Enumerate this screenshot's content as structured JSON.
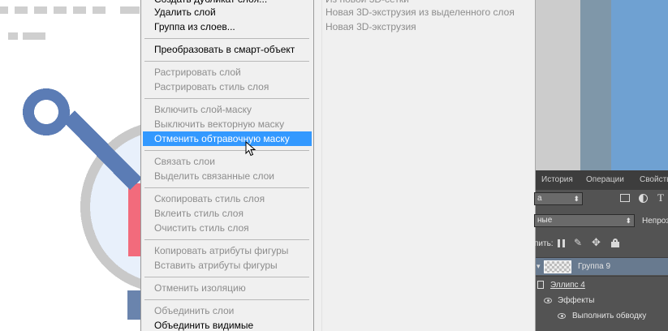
{
  "context_menu": {
    "items": [
      {
        "label": "Создать дубликат слоя...",
        "enabled": true,
        "highlighted": false
      },
      {
        "label": "Удалить слой",
        "enabled": true,
        "highlighted": false
      },
      {
        "label": "Группа из слоев...",
        "enabled": true,
        "highlighted": false
      },
      {
        "label": "Преобразовать в смарт-объект",
        "enabled": true,
        "highlighted": false
      },
      {
        "label": "Растрировать слой",
        "enabled": false,
        "highlighted": false
      },
      {
        "label": "Растрировать стиль слоя",
        "enabled": false,
        "highlighted": false
      },
      {
        "label": "Включить слой-маску",
        "enabled": false,
        "highlighted": false
      },
      {
        "label": "Выключить векторную маску",
        "enabled": false,
        "highlighted": false
      },
      {
        "label": "Отменить обтравочную маску",
        "enabled": true,
        "highlighted": true
      },
      {
        "label": "Связать слои",
        "enabled": false,
        "highlighted": false
      },
      {
        "label": "Выделить связанные слои",
        "enabled": false,
        "highlighted": false
      },
      {
        "label": "Скопировать стиль слоя",
        "enabled": false,
        "highlighted": false
      },
      {
        "label": "Вклеить стиль слоя",
        "enabled": false,
        "highlighted": false
      },
      {
        "label": "Очистить стиль слоя",
        "enabled": false,
        "highlighted": false
      },
      {
        "label": "Копировать атрибуты фигуры",
        "enabled": false,
        "highlighted": false
      },
      {
        "label": "Вставить атрибуты фигуры",
        "enabled": false,
        "highlighted": false
      },
      {
        "label": "Отменить изоляцию",
        "enabled": false,
        "highlighted": false
      },
      {
        "label": "Объединить слои",
        "enabled": false,
        "highlighted": false
      },
      {
        "label": "Объединить видимые",
        "enabled": true,
        "highlighted": false
      }
    ]
  },
  "submenu": {
    "items": [
      {
        "label": "Из новой 3D-сетки",
        "enabled": false
      },
      {
        "label": "Новая 3D-экструзия из выделенного слоя",
        "enabled": false
      },
      {
        "label": "Новая 3D-экструзия",
        "enabled": false
      }
    ]
  },
  "layers_panel": {
    "tabs": [
      {
        "label": "История",
        "active": false
      },
      {
        "label": "Операции",
        "active": false
      },
      {
        "label": "Свойства",
        "active": false
      }
    ],
    "kind_filter": "а",
    "blend_mode": "ные",
    "opacity_label": "Непроз",
    "lock_label": "пить:",
    "layers": [
      {
        "name": "Группа 9",
        "selected": true
      },
      {
        "name": "Эллипс 4",
        "selected": false
      },
      {
        "name": "Эффекты",
        "selected": false
      },
      {
        "name": "Выполнить обводку",
        "selected": false
      }
    ]
  },
  "colors": {
    "menu_highlight": "#3399ff",
    "panel_bg": "#535353",
    "selected_layer": "#687a8f",
    "icon_blue": "#5b7cb5",
    "icon_pink": "#f26b7c"
  }
}
